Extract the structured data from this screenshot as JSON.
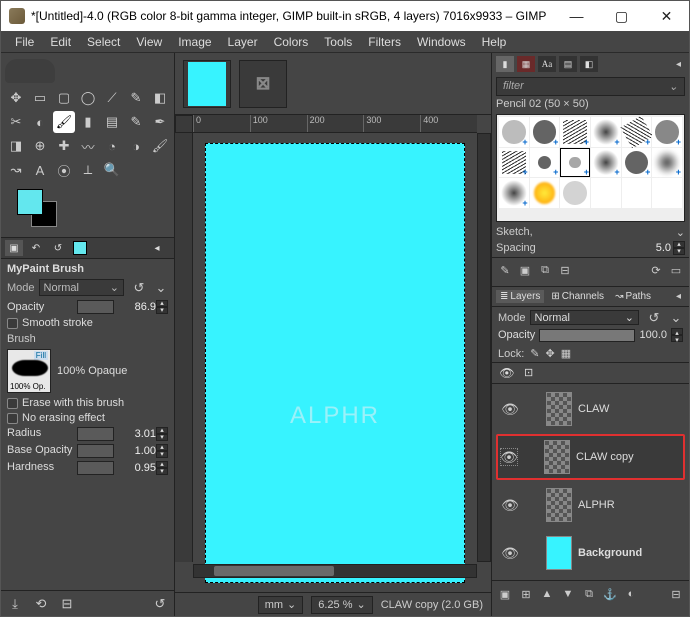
{
  "window": {
    "title": "*[Untitled]-4.0 (RGB color 8-bit gamma integer, GIMP built-in sRGB, 4 layers) 7016x9933 – GIMP"
  },
  "menubar": [
    "File",
    "Edit",
    "Select",
    "View",
    "Image",
    "Layer",
    "Colors",
    "Tools",
    "Filters",
    "Windows",
    "Help"
  ],
  "toolbox": {
    "tools": [
      "move",
      "align",
      "rect-select",
      "ellipse-select",
      "free-select",
      "fuzzy-select",
      "color-select",
      "scissors",
      "foreground",
      "paintbrush",
      "bucket",
      "gradient",
      "pencil",
      "ink",
      "eraser",
      "clone",
      "heal",
      "smudge",
      "blur",
      "dodge",
      "mypaint",
      "path",
      "text",
      "color-picker",
      "measure",
      "zoom"
    ],
    "active_tool_index": 9
  },
  "colors": {
    "fg": "#63e7ee",
    "bg": "#000000"
  },
  "tool_options": {
    "title": "MyPaint Brush",
    "mode_label": "Mode",
    "mode_value": "Normal",
    "opacity_label": "Opacity",
    "opacity_value": "86.9",
    "smooth_stroke": "Smooth stroke",
    "brush_label": "Brush",
    "brush_fill": "Fill",
    "brush_op": "100% Op.",
    "brush_opaque": "100% Opaque",
    "erase_chk": "Erase with this brush",
    "noerase_chk": "No erasing effect",
    "radius_label": "Radius",
    "radius_value": "3.01",
    "baseop_label": "Base Opacity",
    "baseop_value": "1.00",
    "hardness_label": "Hardness",
    "hardness_value": "0.95"
  },
  "canvas": {
    "ruler_marks": [
      "0",
      "100",
      "200",
      "300",
      "400"
    ],
    "watermark": "ALPHR"
  },
  "statusbar": {
    "unit": "mm",
    "zoom": "6.25 %",
    "status": "CLAW copy (2.0 GB)"
  },
  "brushes": {
    "filter_placeholder": "filter",
    "current": "Pencil 02 (50 × 50)",
    "category": "Sketch,",
    "spacing_label": "Spacing",
    "spacing_value": "5.0"
  },
  "layers_panel": {
    "tabs": {
      "layers": "Layers",
      "channels": "Channels",
      "paths": "Paths"
    },
    "mode_label": "Mode",
    "mode_value": "Normal",
    "opacity_label": "Opacity",
    "opacity_value": "100.0",
    "lock_label": "Lock:",
    "items": [
      {
        "name": "CLAW",
        "thumb": "checker",
        "selected": false,
        "bold": false
      },
      {
        "name": "CLAW copy",
        "thumb": "checker",
        "selected": true,
        "bold": false
      },
      {
        "name": "ALPHR",
        "thumb": "checker",
        "selected": false,
        "bold": false
      },
      {
        "name": "Background",
        "thumb": "cyan",
        "selected": false,
        "bold": true
      }
    ]
  }
}
